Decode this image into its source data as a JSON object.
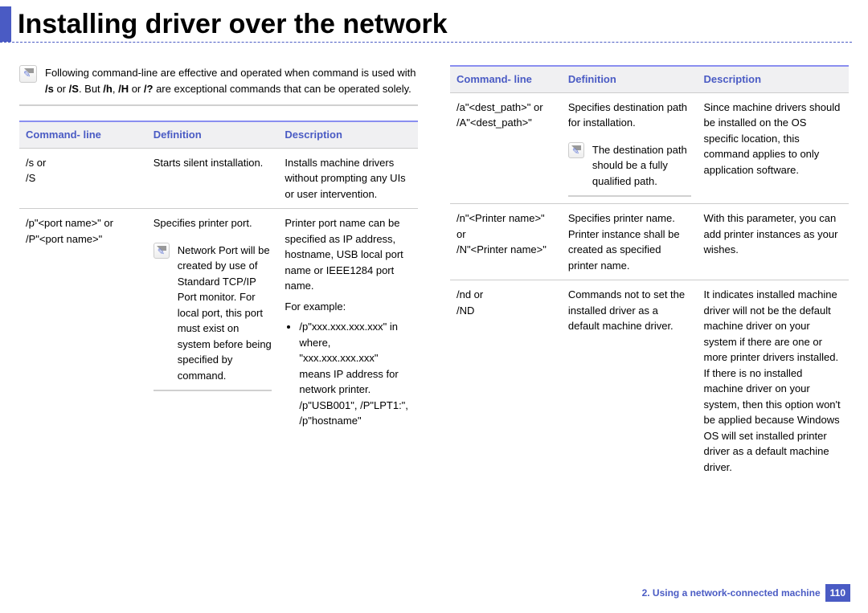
{
  "header": {
    "title": "Installing driver over the network"
  },
  "note": {
    "prefix": "Following command-line are effective and operated when command is used with ",
    "b1": "/s",
    "mid1": " or ",
    "b2": "/S",
    "mid2": ". But ",
    "b3": "/h",
    "mid3": ", ",
    "b4": "/H",
    "mid4": " or ",
    "b5": "/?",
    "suffix": " are exceptional commands that can be operated solely."
  },
  "th": {
    "cmd": "Command- line",
    "def": "Definition",
    "desc": "Description"
  },
  "left": {
    "r1": {
      "cmd1": "/s or",
      "cmd2": "/S",
      "def": "Starts silent installation.",
      "desc": "Installs machine drivers without prompting any UIs or user intervention."
    },
    "r2": {
      "cmd1": "/p\"<port name>\" or",
      "cmd2": "/P\"<port name>\"",
      "defLine": "Specifies printer port.",
      "defNote": "Network Port will be created by use of Standard TCP/IP Port monitor. For local port, this port must exist on system before being specified by command.",
      "descP1": "Printer port name can be specified as IP address, hostname, USB local port name or IEEE1284 port name.",
      "descP2": "For example:",
      "descLi": "/p\"xxx.xxx.xxx.xxx\" in where, \"xxx.xxx.xxx.xxx\" means IP address for network printer. /p\"USB001\", /P\"LPT1:\", /p\"hostname\""
    }
  },
  "right": {
    "r1": {
      "cmd1": "/a\"<dest_path>\" or",
      "cmd2": "/A\"<dest_path>\"",
      "defLine": "Specifies destination path for installation.",
      "defNote": "The destination path should be a fully qualified path.",
      "desc": "Since machine drivers should be installed on the OS specific location, this command applies to only application software."
    },
    "r2": {
      "cmd1": "/n\"<Printer name>\" or",
      "cmd2": "/N\"<Printer name>\"",
      "def": "Specifies printer name. Printer instance shall be created as specified printer name.",
      "desc": "With this parameter, you can add printer instances as your wishes."
    },
    "r3": {
      "cmd1": "/nd or",
      "cmd2": "/ND",
      "def": "Commands not to set the installed driver as a default machine driver.",
      "desc": "It indicates installed machine driver will not be the default machine driver on your system if there are one or more printer drivers installed. If there is no installed machine driver on your system, then this option won't be applied because Windows OS will set installed printer driver as a default machine driver."
    }
  },
  "footer": {
    "section": "2.  Using a network-connected machine",
    "page": "110"
  }
}
